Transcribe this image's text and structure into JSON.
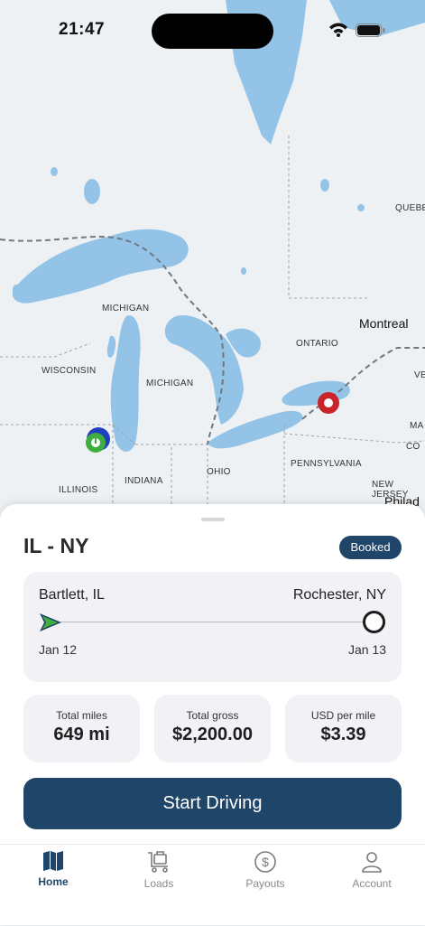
{
  "status_bar": {
    "time": "21:47",
    "icons": [
      "wifi-icon",
      "battery-icon"
    ]
  },
  "map": {
    "region_labels": [
      "MICHIGAN",
      "WISCONSIN",
      "MICHIGAN",
      "ONTARIO",
      "ILLINOIS",
      "INDIANA",
      "OHIO",
      "PENNSYLVANIA",
      "NEW JERSEY",
      "QUEBEC",
      "MA",
      "VE",
      "CO"
    ],
    "city_labels": [
      "Montreal",
      "Philad"
    ],
    "colors": {
      "water": "#93c4e8",
      "land": "#eef1f3",
      "origin_pin": "#3fae3f",
      "origin_ring": "#1f3fbf",
      "destination_pin": "#c8242a"
    }
  },
  "sheet": {
    "route_title": "IL - NY",
    "status_badge": "Booked",
    "route": {
      "origin": "Bartlett, IL",
      "destination": "Rochester, NY",
      "start_date": "Jan 12",
      "end_date": "Jan 13"
    },
    "stats": [
      {
        "label": "Total miles",
        "value": "649 mi"
      },
      {
        "label": "Total gross",
        "value": "$2,200.00"
      },
      {
        "label": "USD per mile",
        "value": "$3.39"
      }
    ],
    "primary_action": "Start Driving",
    "colors": {
      "accent": "#1f4569"
    }
  },
  "tabbar": {
    "tabs": [
      {
        "label": "Home",
        "icon": "map-icon",
        "active": true
      },
      {
        "label": "Loads",
        "icon": "cart-icon",
        "active": false
      },
      {
        "label": "Payouts",
        "icon": "dollar-icon",
        "active": false
      },
      {
        "label": "Account",
        "icon": "person-icon",
        "active": false
      }
    ]
  }
}
